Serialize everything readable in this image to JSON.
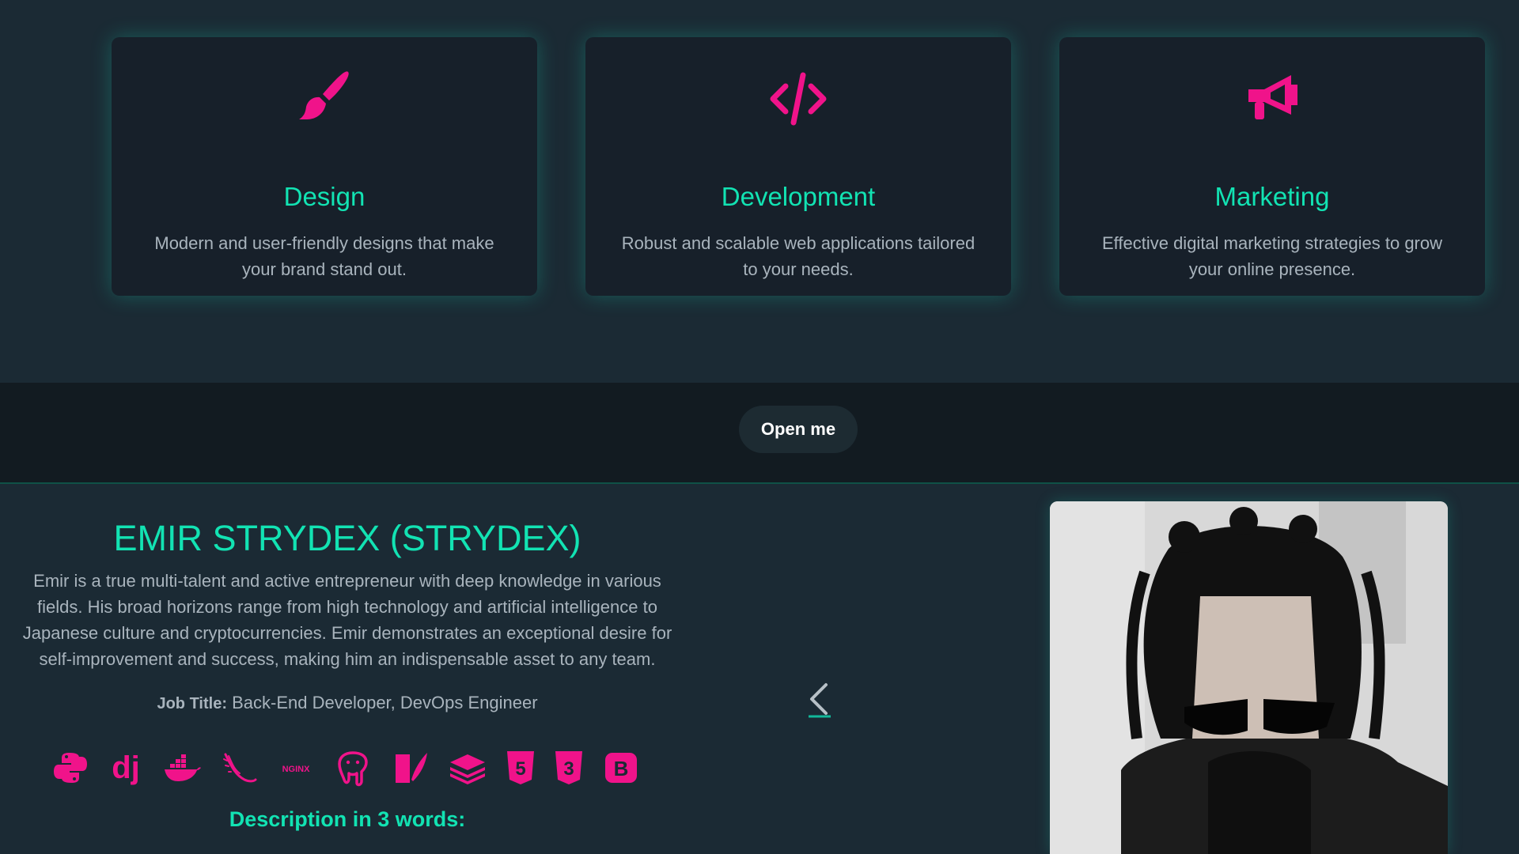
{
  "services": [
    {
      "title": "Design",
      "description": "Modern and user-friendly designs that make your brand stand out.",
      "icon": "paintbrush-icon"
    },
    {
      "title": "Development",
      "description": "Robust and scalable web applications tailored to your needs.",
      "icon": "code-icon"
    },
    {
      "title": "Marketing",
      "description": "Effective digital marketing strategies to grow your online presence.",
      "icon": "megaphone-icon"
    }
  ],
  "banner": {
    "button_label": "Open me"
  },
  "profile": {
    "name": "EMIR STRYDEX (STRYDEX)",
    "bio": "Emir is a true multi-talent and active entrepreneur with deep knowledge in various fields. His broad horizons range from high technology and artificial intelligence to Japanese culture and cryptocurrencies. Emir demonstrates an exceptional desire for self-improvement and success, making him an indispensable asset to any team.",
    "job_label": "Job Title:",
    "job_value": "Back-End Developer, DevOps Engineer",
    "skills": [
      {
        "icon": "python-icon"
      },
      {
        "icon": "django-icon",
        "text": "dj"
      },
      {
        "icon": "docker-icon"
      },
      {
        "icon": "flask-icon"
      },
      {
        "icon": "nginx-icon",
        "text": "NGINX"
      },
      {
        "icon": "postgresql-icon"
      },
      {
        "icon": "gunicorn-icon"
      },
      {
        "icon": "redis-icon"
      },
      {
        "icon": "html5-icon",
        "text": "5"
      },
      {
        "icon": "css3-icon",
        "text": "3"
      },
      {
        "icon": "bootstrap-icon",
        "text": "B"
      }
    ],
    "description_title": "Description in 3 words:"
  },
  "colors": {
    "accent": "#12e3b3",
    "icon_pink": "#f0138a",
    "card_bg": "#17202a",
    "page_bg": "#1b2a34",
    "banner_bg": "#121b21",
    "text_muted": "#a9b4bd"
  }
}
